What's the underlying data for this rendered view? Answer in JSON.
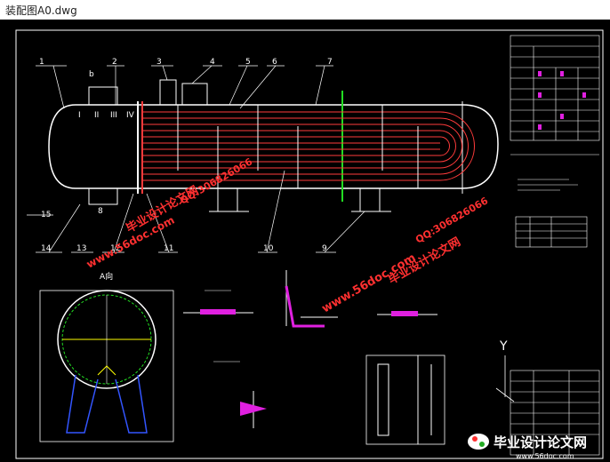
{
  "window": {
    "title": "装配图A0.dwg"
  },
  "drawing": {
    "part_labels": [
      "1",
      "2",
      "3",
      "4",
      "5",
      "6",
      "7",
      "8",
      "9",
      "10",
      "11",
      "12",
      "13",
      "14",
      "15"
    ],
    "section_marks": [
      "I",
      "II",
      "III",
      "IV"
    ],
    "view_label": "A向",
    "small_label_b": "b",
    "view_north": "Y"
  },
  "watermarks": {
    "site": "www.56doc.com",
    "name": "毕业设计论文网",
    "qq": "QQ:306826066"
  },
  "logo": {
    "text": "毕业设计论文网",
    "url": "www.56doc.com"
  },
  "colors": {
    "frame": "#ffffff",
    "tubes": "#ff3b3b",
    "magenta": "#e020e0",
    "green": "#22dd22",
    "yellow": "#ffff00",
    "cyan": "#00e0e0",
    "blue": "#3355ff"
  }
}
